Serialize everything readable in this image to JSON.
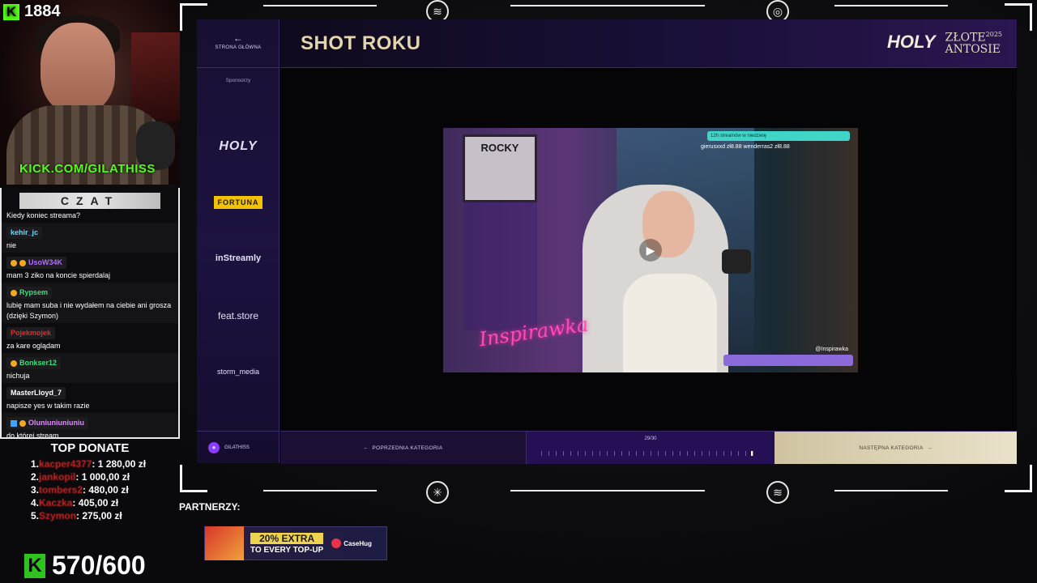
{
  "stream": {
    "viewer_count": "1884",
    "kick_url": "KICK.COM/GILATHISS",
    "sub_goal": "570/600"
  },
  "chat": {
    "header": "CZAT",
    "messages": [
      {
        "user": "",
        "text": "Kiedy koniec streama?"
      },
      {
        "user": "kehir_jc",
        "text": "nie"
      },
      {
        "user": "UsoW34K",
        "text": "mam 3 ziko na koncie spierdalaj",
        "color": "#b36cff"
      },
      {
        "user": "Rypsem",
        "text": "lubię mam suba i nie wydałem na ciebie ani grosza (dzięki Szymon)",
        "color": "#35e07a"
      },
      {
        "user": "Pojekmojek",
        "text": "za kare oglądam",
        "color": "#e02d2d"
      },
      {
        "user": "Bonkser12",
        "text": "nichuja",
        "color": "#35e07a"
      },
      {
        "user": "MasterLloyd_7",
        "text": "napisze yes w takim razie",
        "color": "#ffffff"
      },
      {
        "user": "Oluniuniuniuniu",
        "text": "do której stream",
        "color": "#e08aff"
      }
    ]
  },
  "top_donate": {
    "title": "TOP DONATE",
    "entries": [
      {
        "rank": "1.",
        "name": "kacper4377",
        "amount": ": 1 280,00 zł"
      },
      {
        "rank": "2.",
        "name": "jankopil",
        "amount": ": 1 000,00 zł"
      },
      {
        "rank": "3.",
        "name": "tombers2",
        "amount": ": 480,00 zł"
      },
      {
        "rank": "4.",
        "name": "Kaczka",
        "amount": ": 405,00 zł"
      },
      {
        "rank": "5.",
        "name": "Szymon",
        "amount": ": 275,00 zł"
      }
    ]
  },
  "awards": {
    "home_label": "STRONA GŁÓWNA",
    "sponsors_label": "Sponsorzy",
    "sponsors": [
      "HOLY",
      "FORTUNA",
      "inStreamly",
      "feat.store",
      "storm_media"
    ],
    "user_label": "GILATHISS",
    "category_title": "SHOT ROKU",
    "brand_holy": "HOLY",
    "brand_zlote": "ZŁOTE",
    "brand_antosie": "ANTOSIE",
    "brand_year": "2025",
    "prev_label": "POPRZEDNIA KATEGORIA",
    "next_label": "NASTĘPNA KATEGORIA",
    "progress_text": "29/30",
    "progress_fraction": 0.967
  },
  "video": {
    "poster_text": "ROCKY",
    "neon_text": "Inspirawka",
    "handle": "@Inspirawka",
    "top_bar": "12h streamów w niedzielę",
    "top_names": "gierusxxd zł8.88   wenderras2 zł8.88"
  },
  "partners": {
    "label": "PARTNERZY:",
    "ad_pct": "20% EXTRA",
    "ad_sub": "TO EVERY TOP-UP",
    "ad_brand": "CaseHug"
  }
}
